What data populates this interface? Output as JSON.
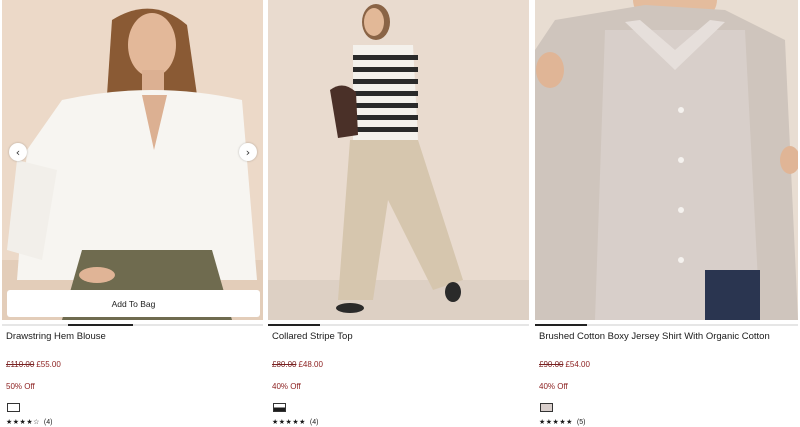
{
  "products": [
    {
      "name": "Drawstring Hem Blouse",
      "was_price": "£110.00",
      "now_price": "£55.00",
      "discount": "50% Off",
      "stars": "★★★★☆",
      "review_count": "(4)",
      "add_to_bag_label": "Add To Bag",
      "prev_icon": "‹",
      "next_icon": "›",
      "swatch_color": "#ffffff"
    },
    {
      "name": "Collared Stripe Top",
      "was_price": "£80.00",
      "now_price": "£48.00",
      "discount": "40% Off",
      "stars": "★★★★★",
      "review_count": "(4)",
      "swatch_color": "#1c1c1c"
    },
    {
      "name": "Brushed Cotton Boxy Jersey Shirt With Organic Cotton",
      "was_price": "£90.00",
      "now_price": "£54.00",
      "discount": "40% Off",
      "stars": "★★★★★",
      "review_count": "(5)",
      "swatch_color": "#d9cfcc"
    }
  ]
}
